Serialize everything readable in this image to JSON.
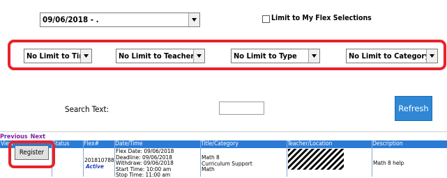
{
  "date_select": {
    "value": "09/06/2018 - ."
  },
  "limit_checkbox": {
    "label": "Limit to My Flex Selections"
  },
  "filters": [
    {
      "value": "No Limit to Time"
    },
    {
      "value": "No Limit to Teacher"
    },
    {
      "value": "No Limit to Type"
    },
    {
      "value": "No Limit to Category"
    }
  ],
  "search": {
    "label": "Search Text:",
    "value": ""
  },
  "refresh_label": "Refresh",
  "pager": {
    "previous": "Previous",
    "next": "Next"
  },
  "table": {
    "headers": [
      "View",
      "Status",
      "Flex#",
      "Date/Time",
      "Title/Category",
      "Teacher/Location",
      "Description"
    ],
    "row": {
      "button": "Register",
      "flex_number": "201810788",
      "status": "Active",
      "datetime": [
        "Flex Date: 09/06/2018",
        "Deadline: 09/06/2018",
        "Withdraw: 09/06/2018",
        "Start Time: 10:00 am",
        "Stop Time: 11:00 am"
      ],
      "title_category": [
        "Math 8",
        "Curriculum Support",
        "Math"
      ],
      "description": "Math 8 help"
    }
  },
  "colors": {
    "highlight": "#e8222a",
    "header": "#2b7bd6",
    "refresh": "#2f87d6",
    "status_active": "#1f3fbf"
  }
}
